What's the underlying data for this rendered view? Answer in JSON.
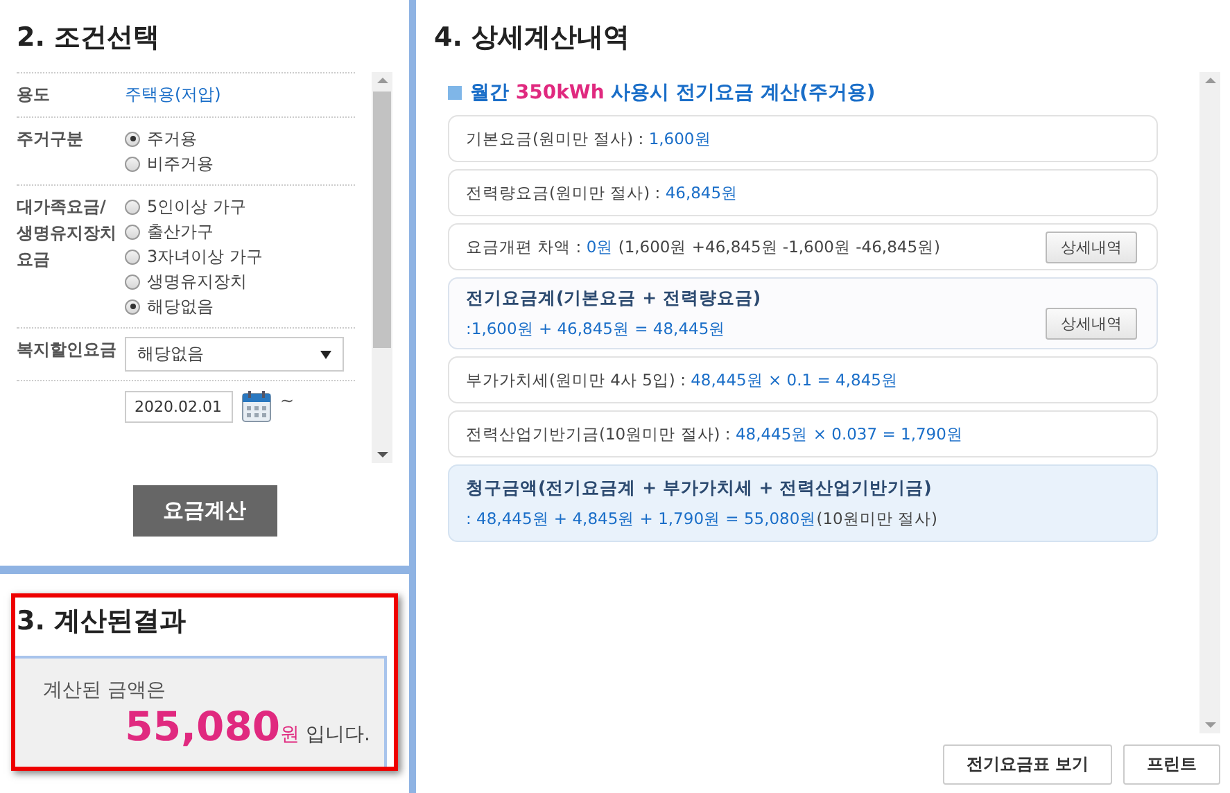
{
  "conditions": {
    "heading": "2. 조건선택",
    "rows": [
      {
        "kind": "text",
        "label": "용도",
        "value": "주택용(저압)"
      },
      {
        "kind": "radio",
        "label": "주거구분",
        "options": [
          {
            "label": "주거용",
            "selected": true
          },
          {
            "label": "비주거용",
            "selected": false
          }
        ]
      },
      {
        "kind": "radio",
        "label": "대가족요금/생명유지장치요금",
        "options": [
          {
            "label": "5인이상 가구",
            "selected": false
          },
          {
            "label": "출산가구",
            "selected": false
          },
          {
            "label": "3자녀이상 가구",
            "selected": false
          },
          {
            "label": "생명유지장치",
            "selected": false
          },
          {
            "label": "해당없음",
            "selected": true
          }
        ]
      },
      {
        "kind": "select",
        "label": "복지할인요금",
        "value": "해당없음"
      },
      {
        "kind": "date",
        "value": "2020.02.01",
        "separator": "~"
      }
    ],
    "button": "요금계산"
  },
  "result": {
    "heading": "3. 계산된결과",
    "intro": "계산된 금액은",
    "amount": "55,080",
    "unit": "원",
    "suffix": "입니다."
  },
  "details": {
    "heading": "4. 상세계산내역",
    "title": {
      "prefix": "월간 ",
      "highlight": "350kWh",
      "suffix": " 사용시 전기요금 계산(주거용)"
    },
    "items": [
      {
        "kind": "line",
        "label": "기본요금(원미만 절사) : ",
        "value": "1,600원"
      },
      {
        "kind": "line",
        "label": "전력량요금(원미만 절사) : ",
        "value": "46,845원"
      },
      {
        "kind": "line",
        "label": "요금개편 차액 : ",
        "value": "0원",
        "note": " (1,600원 +46,845원 -1,600원 -46,845원)",
        "button": "상세내역"
      },
      {
        "kind": "sum",
        "label": "전기요금계(기본요금 + 전력량요금)",
        "value": ":1,600원 + 46,845원 = 48,445원",
        "button": "상세내역"
      },
      {
        "kind": "line",
        "label": "부가가치세(원미만 4사 5입) : ",
        "value": "48,445원 × 0.1 = 4,845원"
      },
      {
        "kind": "line",
        "label": "전력산업기반기금(10원미만 절사) : ",
        "value": "48,445원 × 0.037 = 1,790원"
      },
      {
        "kind": "final",
        "label": "청구금액(전기요금계 + 부가가치세 + 전력산업기반기금)",
        "value": ": 48,445원 + 4,845원 + 1,790원 = 55,080원",
        "note": "(10원미만 절사)"
      }
    ],
    "buttons": [
      "전기요금표 보기",
      "프린트"
    ]
  }
}
